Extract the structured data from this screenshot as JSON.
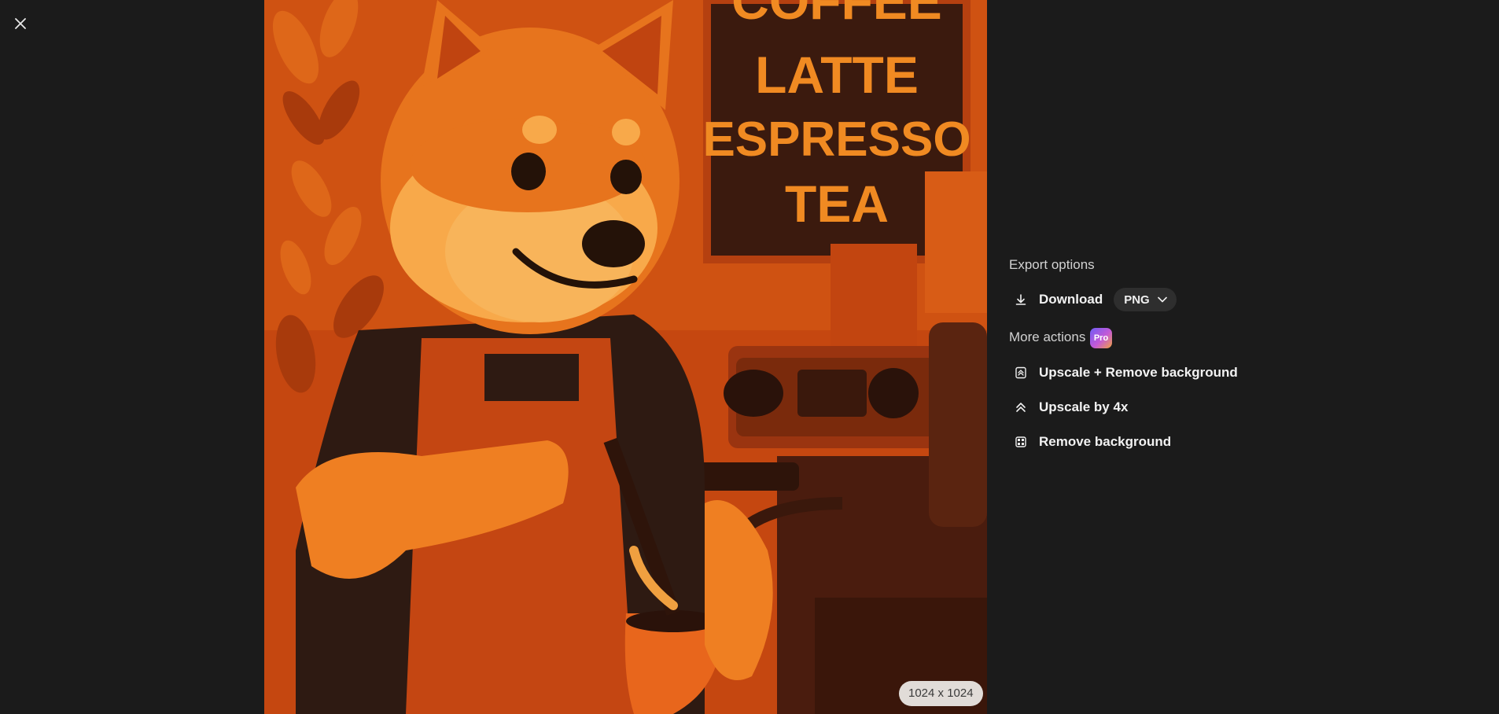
{
  "viewer": {
    "close_icon": "close-icon",
    "image": {
      "menu_lines": [
        "COFFEE",
        "LATTE",
        "ESPRESSO",
        "TEA"
      ],
      "dimensions": "1024 x 1024"
    }
  },
  "panel": {
    "export_title": "Export options",
    "download_label": "Download",
    "download_icon": "download-icon",
    "format_value": "PNG",
    "more_title": "More actions",
    "pro_badge": "Pro",
    "actions": [
      {
        "label": "Upscale + Remove background",
        "icon": "upscale-remove-bg-icon"
      },
      {
        "label": "Upscale by 4x",
        "icon": "upscale-icon"
      },
      {
        "label": "Remove background",
        "icon": "remove-bg-icon"
      }
    ]
  },
  "colors": {
    "background": "#1b1b1b",
    "image_base": "#c84a10",
    "accent_pro_start": "#6f5cf6",
    "accent_pro_end": "#f0a040"
  }
}
